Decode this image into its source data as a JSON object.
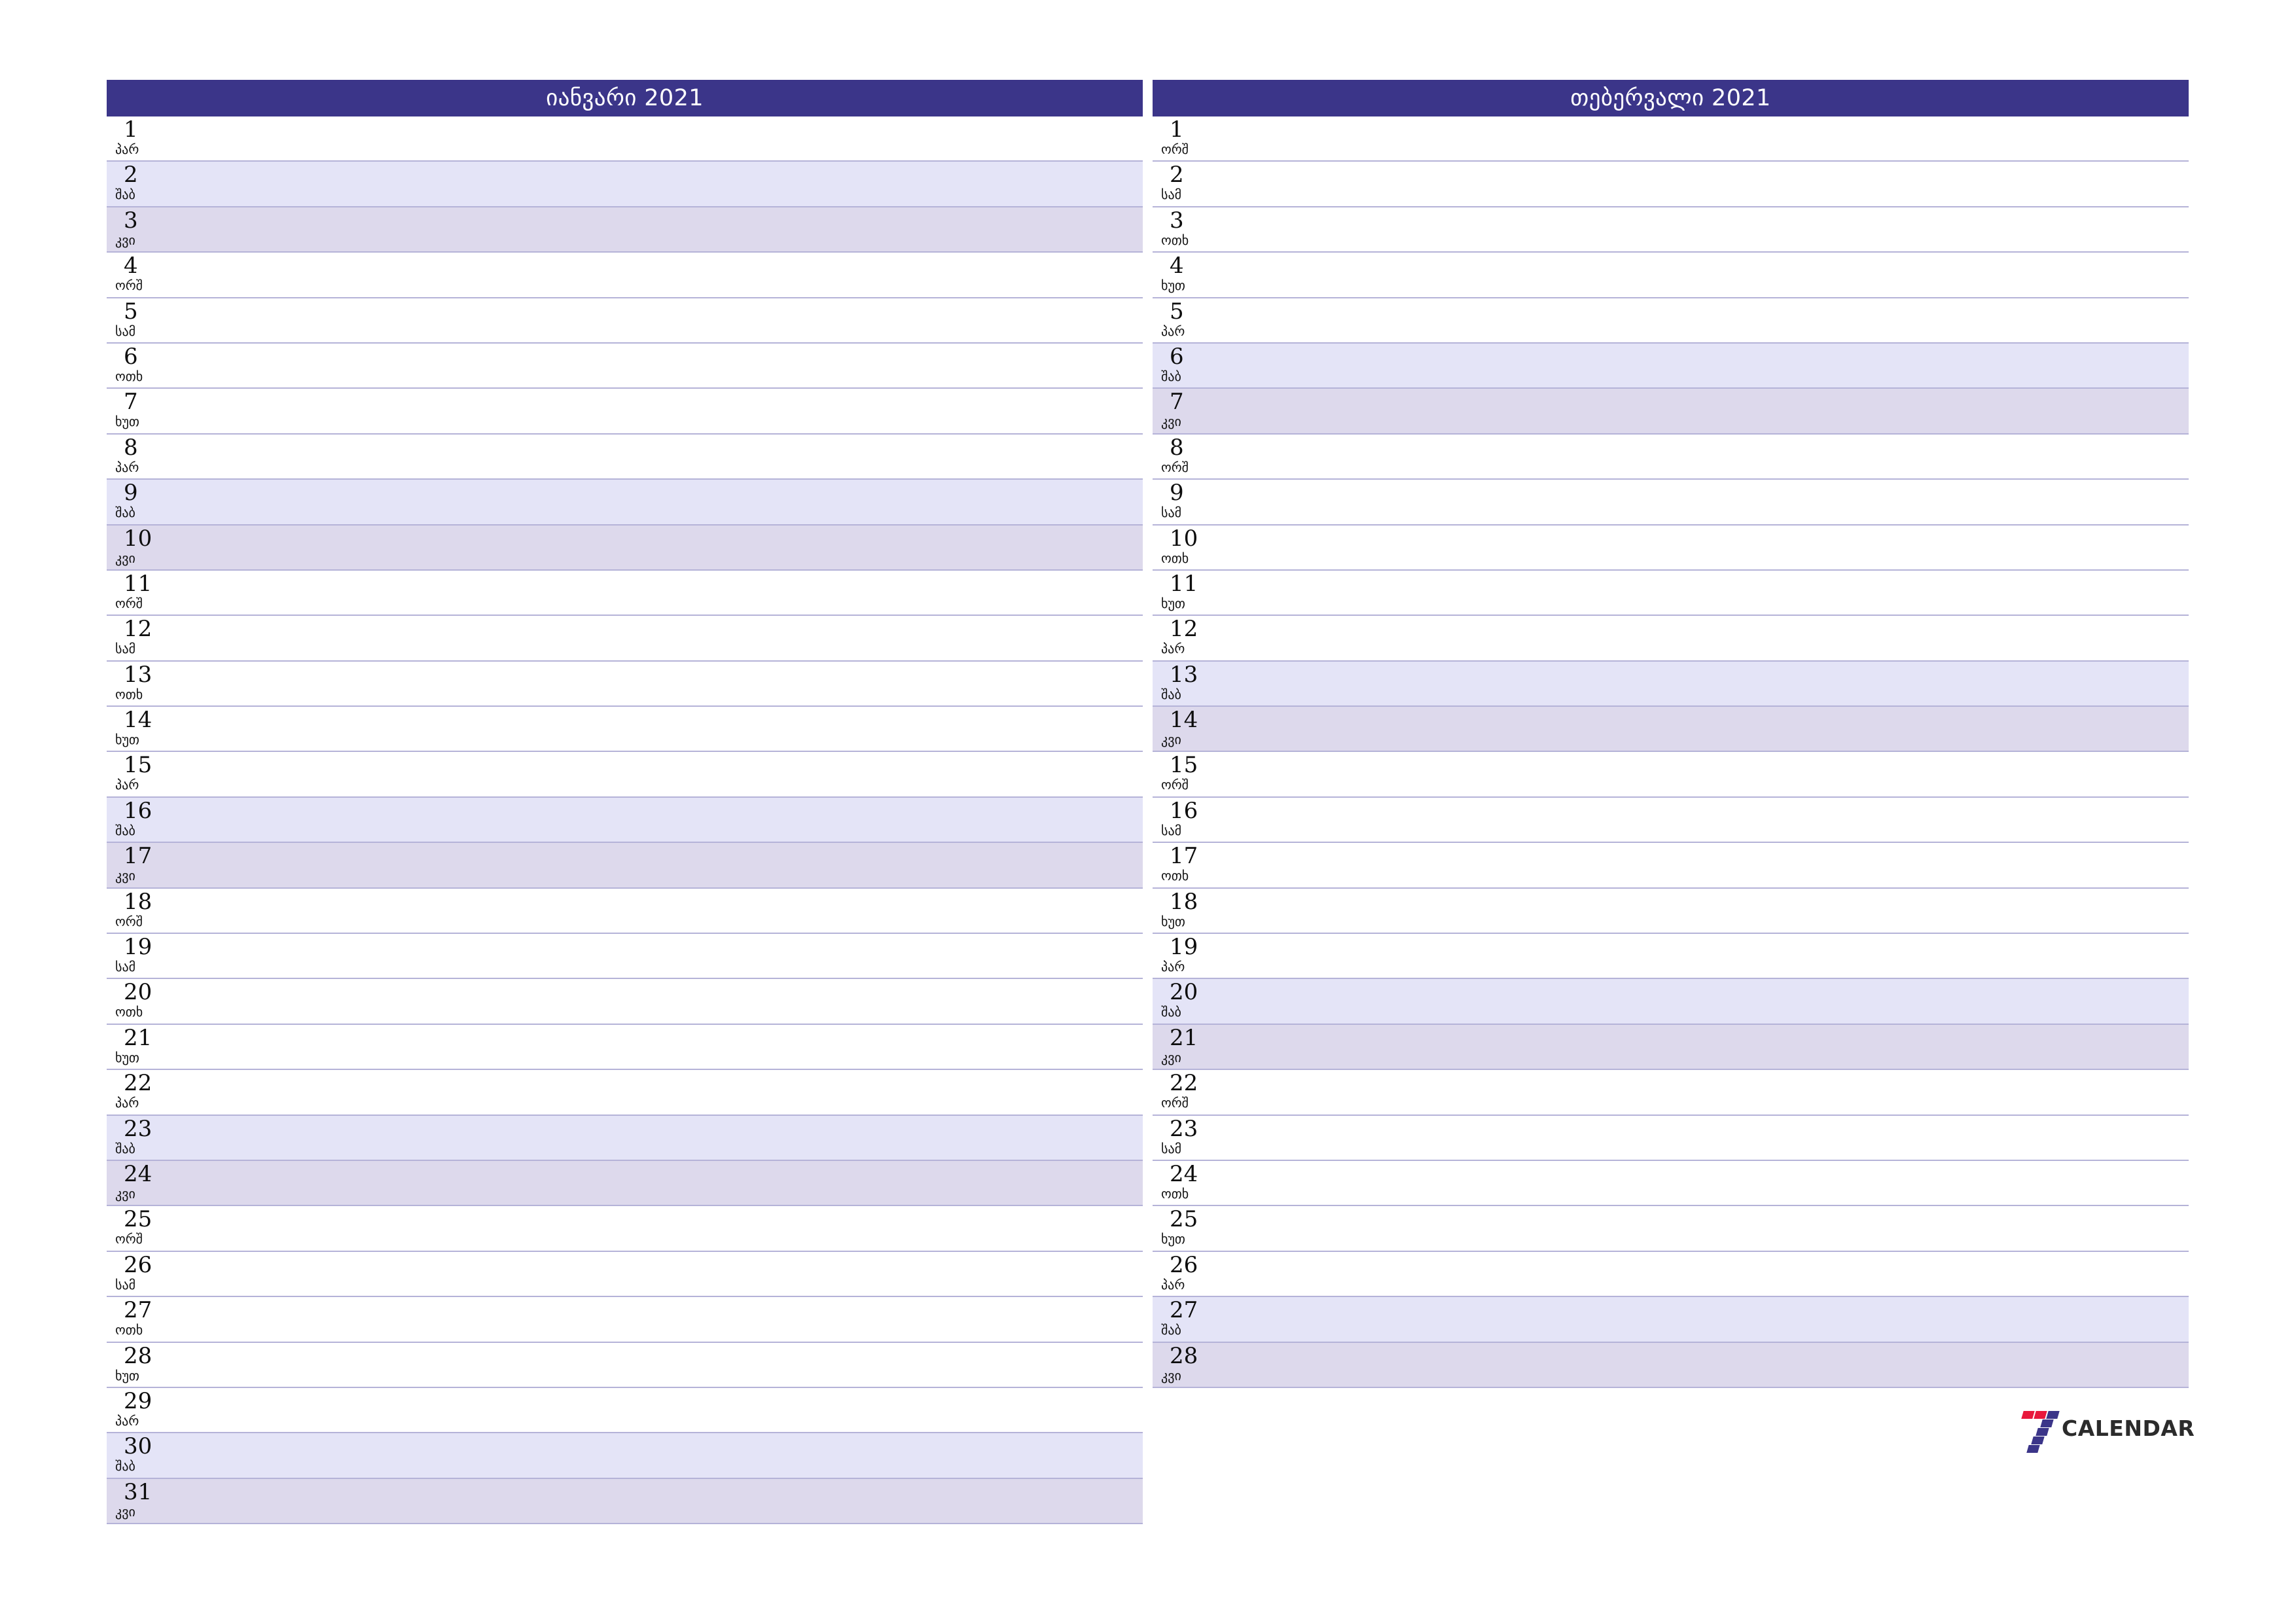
{
  "page": {
    "background_color": "#ffffff",
    "header_color": "#3b3589",
    "saturday_color": "#e4e4f7",
    "sunday_color": "#ddd9ec",
    "border_color": "#b5b3d8"
  },
  "logo": {
    "text": "CALENDAR",
    "mark_red": "#e8183c",
    "mark_blue": "#3b3589",
    "digit": "7"
  },
  "months": [
    {
      "title": "იანვარი 2021",
      "days": [
        {
          "num": "1",
          "name": "პარ",
          "type": "weekday"
        },
        {
          "num": "2",
          "name": "შაბ",
          "type": "sat"
        },
        {
          "num": "3",
          "name": "კვი",
          "type": "sun"
        },
        {
          "num": "4",
          "name": "ორშ",
          "type": "weekday"
        },
        {
          "num": "5",
          "name": "სამ",
          "type": "weekday"
        },
        {
          "num": "6",
          "name": "ოთხ",
          "type": "weekday"
        },
        {
          "num": "7",
          "name": "ხუთ",
          "type": "weekday"
        },
        {
          "num": "8",
          "name": "პარ",
          "type": "weekday"
        },
        {
          "num": "9",
          "name": "შაბ",
          "type": "sat"
        },
        {
          "num": "10",
          "name": "კვი",
          "type": "sun"
        },
        {
          "num": "11",
          "name": "ორშ",
          "type": "weekday"
        },
        {
          "num": "12",
          "name": "სამ",
          "type": "weekday"
        },
        {
          "num": "13",
          "name": "ოთხ",
          "type": "weekday"
        },
        {
          "num": "14",
          "name": "ხუთ",
          "type": "weekday"
        },
        {
          "num": "15",
          "name": "პარ",
          "type": "weekday"
        },
        {
          "num": "16",
          "name": "შაბ",
          "type": "sat"
        },
        {
          "num": "17",
          "name": "კვი",
          "type": "sun"
        },
        {
          "num": "18",
          "name": "ორშ",
          "type": "weekday"
        },
        {
          "num": "19",
          "name": "სამ",
          "type": "weekday"
        },
        {
          "num": "20",
          "name": "ოთხ",
          "type": "weekday"
        },
        {
          "num": "21",
          "name": "ხუთ",
          "type": "weekday"
        },
        {
          "num": "22",
          "name": "პარ",
          "type": "weekday"
        },
        {
          "num": "23",
          "name": "შაბ",
          "type": "sat"
        },
        {
          "num": "24",
          "name": "კვი",
          "type": "sun"
        },
        {
          "num": "25",
          "name": "ორშ",
          "type": "weekday"
        },
        {
          "num": "26",
          "name": "სამ",
          "type": "weekday"
        },
        {
          "num": "27",
          "name": "ოთხ",
          "type": "weekday"
        },
        {
          "num": "28",
          "name": "ხუთ",
          "type": "weekday"
        },
        {
          "num": "29",
          "name": "პარ",
          "type": "weekday"
        },
        {
          "num": "30",
          "name": "შაბ",
          "type": "sat"
        },
        {
          "num": "31",
          "name": "კვი",
          "type": "sun"
        }
      ]
    },
    {
      "title": "თებერვალი 2021",
      "days": [
        {
          "num": "1",
          "name": "ორშ",
          "type": "weekday"
        },
        {
          "num": "2",
          "name": "სამ",
          "type": "weekday"
        },
        {
          "num": "3",
          "name": "ოთხ",
          "type": "weekday"
        },
        {
          "num": "4",
          "name": "ხუთ",
          "type": "weekday"
        },
        {
          "num": "5",
          "name": "პარ",
          "type": "weekday"
        },
        {
          "num": "6",
          "name": "შაბ",
          "type": "sat"
        },
        {
          "num": "7",
          "name": "კვი",
          "type": "sun"
        },
        {
          "num": "8",
          "name": "ორშ",
          "type": "weekday"
        },
        {
          "num": "9",
          "name": "სამ",
          "type": "weekday"
        },
        {
          "num": "10",
          "name": "ოთხ",
          "type": "weekday"
        },
        {
          "num": "11",
          "name": "ხუთ",
          "type": "weekday"
        },
        {
          "num": "12",
          "name": "პარ",
          "type": "weekday"
        },
        {
          "num": "13",
          "name": "შაბ",
          "type": "sat"
        },
        {
          "num": "14",
          "name": "კვი",
          "type": "sun"
        },
        {
          "num": "15",
          "name": "ორშ",
          "type": "weekday"
        },
        {
          "num": "16",
          "name": "სამ",
          "type": "weekday"
        },
        {
          "num": "17",
          "name": "ოთხ",
          "type": "weekday"
        },
        {
          "num": "18",
          "name": "ხუთ",
          "type": "weekday"
        },
        {
          "num": "19",
          "name": "პარ",
          "type": "weekday"
        },
        {
          "num": "20",
          "name": "შაბ",
          "type": "sat"
        },
        {
          "num": "21",
          "name": "კვი",
          "type": "sun"
        },
        {
          "num": "22",
          "name": "ორშ",
          "type": "weekday"
        },
        {
          "num": "23",
          "name": "სამ",
          "type": "weekday"
        },
        {
          "num": "24",
          "name": "ოთხ",
          "type": "weekday"
        },
        {
          "num": "25",
          "name": "ხუთ",
          "type": "weekday"
        },
        {
          "num": "26",
          "name": "პარ",
          "type": "weekday"
        },
        {
          "num": "27",
          "name": "შაბ",
          "type": "sat"
        },
        {
          "num": "28",
          "name": "კვი",
          "type": "sun"
        }
      ]
    }
  ]
}
